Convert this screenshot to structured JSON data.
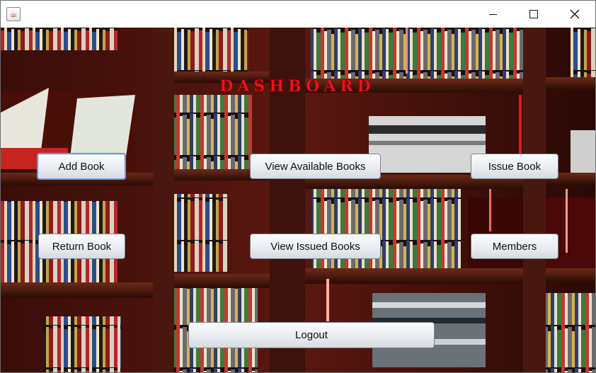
{
  "window": {
    "app_icon": "java-cup-icon",
    "controls": [
      "minimize-icon",
      "maximize-icon",
      "close-icon"
    ]
  },
  "dashboard": {
    "title": "DASHBOARD",
    "buttons": {
      "add_book": "Add Book",
      "view_available_books": "View Available Books",
      "issue_book": "Issue Book",
      "return_book": "Return Book",
      "view_issued_books": "View Issued Books",
      "members": "Members",
      "logout": "Logout"
    }
  },
  "colors": {
    "title": "#f0131b",
    "focus_border": "#6f9bd3"
  }
}
